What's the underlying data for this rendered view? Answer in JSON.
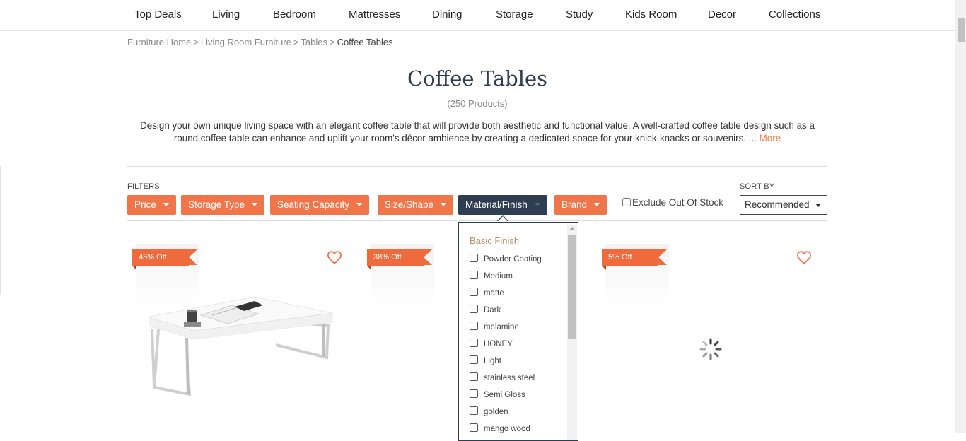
{
  "nav": {
    "items": [
      "Top Deals",
      "Living",
      "Bedroom",
      "Mattresses",
      "Dining",
      "Storage",
      "Study",
      "Kids Room",
      "Decor",
      "Collections"
    ]
  },
  "breadcrumb": {
    "items": [
      "Furniture Home",
      "Living Room Furniture",
      "Tables",
      "Coffee Tables"
    ],
    "separator": ">"
  },
  "page": {
    "title": "Coffee Tables",
    "count": "(250 Products)",
    "description": "Design your own unique living space with an elegant coffee table that will provide both aesthetic and functional value. A well-crafted coffee table design such as a round coffee table can enhance and uplift your room's dēcor ambience by creating a dedicated space for your knick-knacks or souvenirs. ...",
    "more_label": "More"
  },
  "filters": {
    "label": "FILTERS",
    "buttons": [
      "Price",
      "Storage Type",
      "Seating Capacity",
      "Size/Shape",
      "Material/Finish",
      "Brand"
    ],
    "active": "Material/Finish",
    "exclude_label": "Exclude Out Of Stock"
  },
  "sort": {
    "label": "SORT BY",
    "value": "Recommended"
  },
  "material_dropdown": {
    "heading": "Basic Finish",
    "options": [
      "Powder Coating",
      "Medium",
      "matte",
      "Dark",
      "melamine",
      "HONEY",
      "Light",
      "stainless steel",
      "Semi Gloss",
      "golden",
      "mango wood"
    ]
  },
  "products": [
    {
      "discount": "45% Off",
      "image": "white-coffee-table"
    },
    {
      "discount": "38% Off",
      "image": "hidden-behind-dropdown"
    },
    {
      "discount": "5% Off",
      "image": "loading-spinner"
    }
  ],
  "colors": {
    "accent": "#f0764a",
    "dark": "#2e3e50",
    "heart": "#f0764a"
  }
}
